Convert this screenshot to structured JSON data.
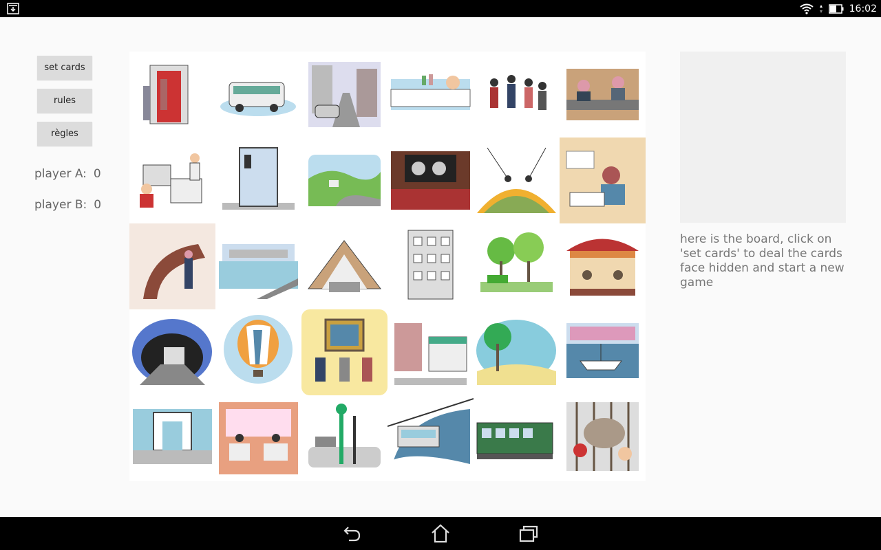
{
  "status_bar": {
    "time": "16:02",
    "icons": [
      "download-icon",
      "wifi-icon",
      "battery-icon"
    ]
  },
  "sidebar": {
    "buttons": [
      {
        "label": "set cards"
      },
      {
        "label": "rules"
      },
      {
        "label": "règles"
      }
    ],
    "players": [
      {
        "label": "player A:",
        "score": "0"
      },
      {
        "label": "player B:",
        "score": "0"
      }
    ]
  },
  "board": {
    "rows": 5,
    "columns": 6,
    "cards": [
      {
        "name": "card-elevator-doorway",
        "icon": "elevator-scene"
      },
      {
        "name": "card-bus",
        "icon": "bus-scene"
      },
      {
        "name": "card-city-street",
        "icon": "street-scene"
      },
      {
        "name": "card-bathtub",
        "icon": "bath-scene"
      },
      {
        "name": "card-dancing-crowd",
        "icon": "crowd-scene"
      },
      {
        "name": "card-cafe-bar",
        "icon": "bar-scene"
      },
      {
        "name": "card-office-computers",
        "icon": "office-scene"
      },
      {
        "name": "card-phone-booth",
        "icon": "phonebooth-scene"
      },
      {
        "name": "card-countryside",
        "icon": "landscape-scene"
      },
      {
        "name": "card-cinema",
        "icon": "cinema-scene"
      },
      {
        "name": "card-circus-trapeze",
        "icon": "circus-scene"
      },
      {
        "name": "card-classroom",
        "icon": "classroom-scene"
      },
      {
        "name": "card-staircase",
        "icon": "staircase-scene"
      },
      {
        "name": "card-river-seine",
        "icon": "river-scene"
      },
      {
        "name": "card-attic",
        "icon": "attic-scene"
      },
      {
        "name": "card-apartment-building",
        "icon": "building-scene"
      },
      {
        "name": "card-park",
        "icon": "park-scene"
      },
      {
        "name": "card-carousel",
        "icon": "carousel-scene"
      },
      {
        "name": "card-metro-station",
        "icon": "metro-scene"
      },
      {
        "name": "card-hot-air-balloon",
        "icon": "balloon-scene"
      },
      {
        "name": "card-museum-painting",
        "icon": "museum-scene"
      },
      {
        "name": "card-village-square",
        "icon": "village-scene"
      },
      {
        "name": "card-tropical-beach",
        "icon": "beach-scene"
      },
      {
        "name": "card-harbor-boats",
        "icon": "harbor-scene"
      },
      {
        "name": "card-grande-arche",
        "icon": "arch-scene"
      },
      {
        "name": "card-restaurant",
        "icon": "restaurant-scene"
      },
      {
        "name": "card-street-lamp",
        "icon": "lamp-scene"
      },
      {
        "name": "card-cable-car",
        "icon": "cablecar-scene"
      },
      {
        "name": "card-train-wagon",
        "icon": "train-scene"
      },
      {
        "name": "card-zoo-elephant",
        "icon": "zoo-scene"
      }
    ]
  },
  "info_text": "here is the board, click on 'set cards' to deal the cards face hidden and start a new game",
  "colors": {
    "background": "#fafafa",
    "button": "#dcdcdc",
    "preview": "#f0f0f0",
    "text_muted": "#777777",
    "bars": "#000000"
  }
}
